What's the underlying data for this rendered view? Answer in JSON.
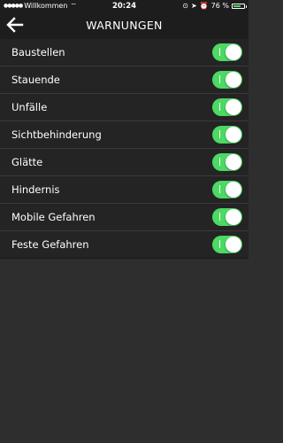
{
  "status_bar": {
    "carrier": "Willkommen",
    "time": "20:24",
    "battery_percent": "76 %",
    "battery_level": 0.76
  },
  "nav": {
    "title": "WARNUNGEN",
    "back_icon": "arrow-left-icon"
  },
  "warnings": [
    {
      "label": "Baustellen",
      "on": true
    },
    {
      "label": "Stauende",
      "on": true
    },
    {
      "label": "Unfälle",
      "on": true
    },
    {
      "label": "Sichtbehinderung",
      "on": true
    },
    {
      "label": "Glätte",
      "on": true
    },
    {
      "label": "Hindernis",
      "on": true
    },
    {
      "label": "Mobile Gefahren",
      "on": true
    },
    {
      "label": "Feste Gefahren",
      "on": true
    }
  ],
  "colors": {
    "toggle_on": "#4cd964",
    "background": "#2e2e2e",
    "bar": "#1d1d1d"
  }
}
